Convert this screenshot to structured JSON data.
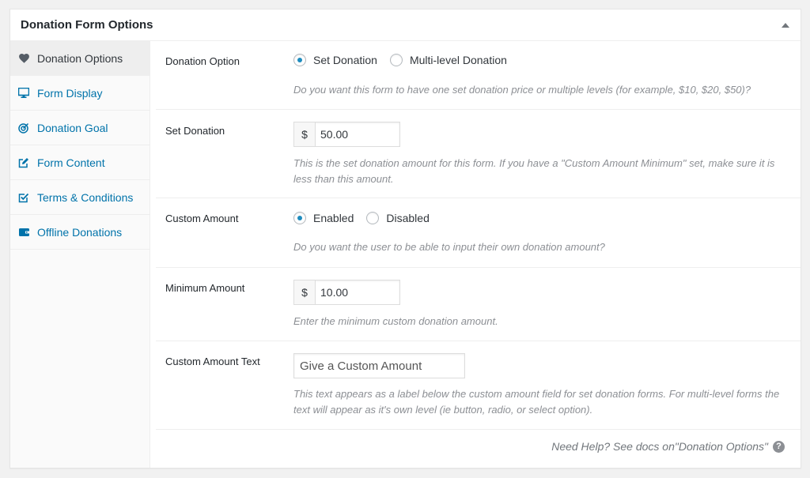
{
  "metabox": {
    "title": "Donation Form Options",
    "toggle_icon": "triangle-up-icon"
  },
  "sidebar": {
    "items": [
      {
        "label": "Donation Options",
        "icon": "heart-icon",
        "active": true
      },
      {
        "label": "Form Display",
        "icon": "monitor-icon",
        "active": false
      },
      {
        "label": "Donation Goal",
        "icon": "target-icon",
        "active": false
      },
      {
        "label": "Form Content",
        "icon": "edit-icon",
        "active": false
      },
      {
        "label": "Terms & Conditions",
        "icon": "checkbox-icon",
        "active": false
      },
      {
        "label": "Offline Donations",
        "icon": "wallet-icon",
        "active": false
      }
    ]
  },
  "fields": {
    "donation_option": {
      "label": "Donation Option",
      "options": [
        "Set Donation",
        "Multi-level Donation"
      ],
      "selected": "Set Donation",
      "description": "Do you want this form to have one set donation price or multiple levels (for example, $10, $20, $50)?"
    },
    "set_donation": {
      "label": "Set Donation",
      "currency": "$",
      "value": "50.00",
      "description": "This is the set donation amount for this form. If you have a \"Custom Amount Minimum\" set, make sure it is less than this amount."
    },
    "custom_amount": {
      "label": "Custom Amount",
      "options": [
        "Enabled",
        "Disabled"
      ],
      "selected": "Enabled",
      "description": "Do you want the user to be able to input their own donation amount?"
    },
    "minimum_amount": {
      "label": "Minimum Amount",
      "currency": "$",
      "value": "10.00",
      "description": "Enter the minimum custom donation amount."
    },
    "custom_amount_text": {
      "label": "Custom Amount Text",
      "value": "Give a Custom Amount",
      "description": "This text appears as a label below the custom amount field for set donation forms. For multi-level forms the text will appear as it's own level (ie button, radio, or select option)."
    }
  },
  "help": {
    "prefix": "Need Help? See docs on ",
    "link_text": "\"Donation Options\"",
    "icon": "question-icon"
  },
  "colors": {
    "link": "#0073aa",
    "radio_checked": "#1e8cbe",
    "description": "#8c8f94"
  }
}
